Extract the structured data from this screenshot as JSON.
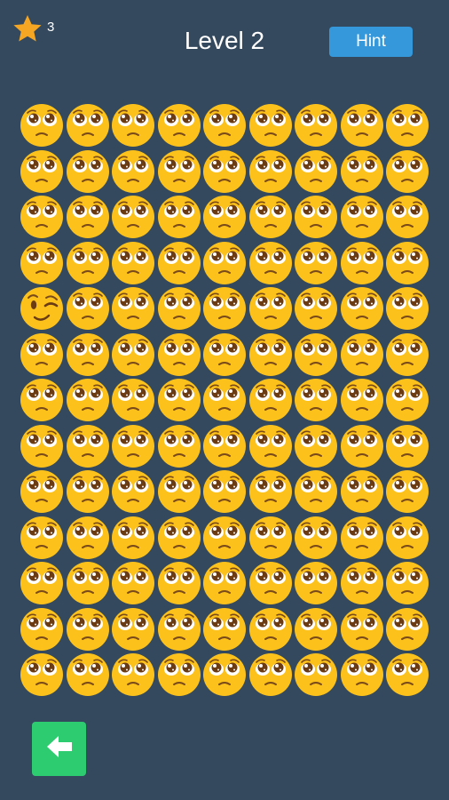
{
  "header": {
    "stars_count": "3",
    "title": "Level 2",
    "hint_label": "Hint"
  },
  "grid": {
    "rows": 13,
    "cols": 9,
    "base_emoji": "pleading-face",
    "odd_emoji": "winking-face",
    "odd_position": {
      "row": 5,
      "col": 1
    }
  },
  "icons": {
    "star": "star-icon",
    "back": "arrow-left-icon"
  },
  "colors": {
    "background": "#34495e",
    "hint_button": "#3498db",
    "back_button": "#2ecc71",
    "star": "#f5a623",
    "emoji_face": "#fcc21b"
  }
}
